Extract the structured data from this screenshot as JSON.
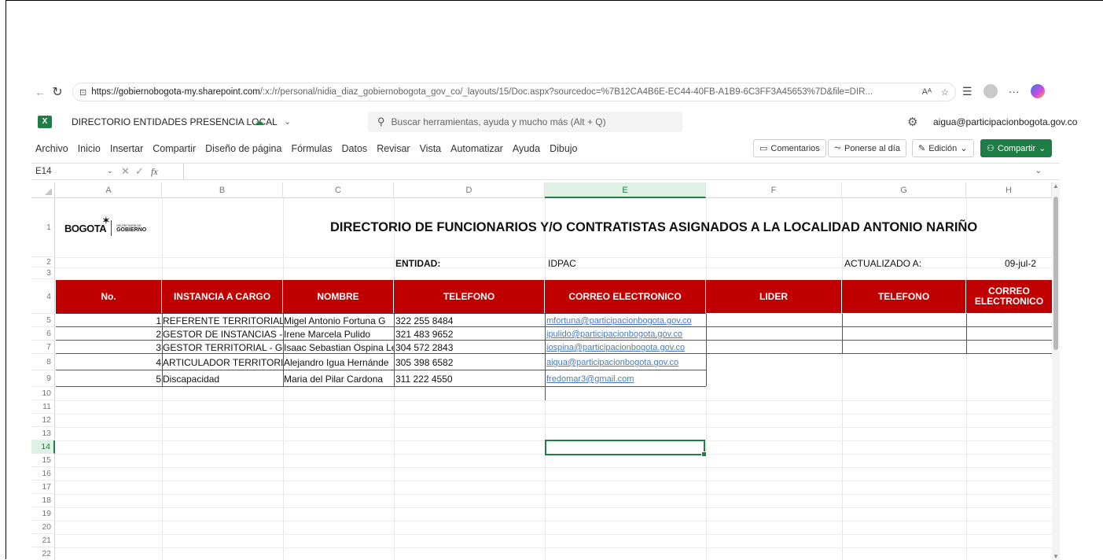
{
  "browser": {
    "url_host": "https://gobiernobogota-my.sharepoint.com",
    "url_rest": "/:x:/r/personal/nidia_diaz_gobiernobogota_gov_co/_layouts/15/Doc.aspx?sourcedoc=%7B12CA4B6E-EC44-40FB-A1B9-6C3FF3A45653%7D&file=DIR...",
    "read_aloud": "Aᴬ"
  },
  "excel": {
    "doc_name": "DIRECTORIO ENTIDADES PRESENCIA LOCAL",
    "search_placeholder": "Buscar herramientas, ayuda y mucho más (Alt + Q)",
    "account": "aigua@participacionbogota.gov.co",
    "tabs": [
      "Archivo",
      "Inicio",
      "Insertar",
      "Compartir",
      "Diseño de página",
      "Fórmulas",
      "Datos",
      "Revisar",
      "Vista",
      "Automatizar",
      "Ayuda",
      "Dibujo"
    ],
    "comments_label": "Comentarios",
    "catchup_label": "Ponerse al día",
    "edit_label": "Edición",
    "share_label": "Compartir",
    "name_box": "E14",
    "fx_label": "fx",
    "accent": "#1e7e45"
  },
  "sheet": {
    "columns": [
      "A",
      "B",
      "C",
      "D",
      "E",
      "F",
      "G",
      "H"
    ],
    "rows": [
      "1",
      "2",
      "3",
      "4",
      "5",
      "6",
      "7",
      "8",
      "9",
      "10",
      "11",
      "12",
      "13",
      "14",
      "15",
      "16",
      "17",
      "18",
      "19",
      "20",
      "21",
      "22"
    ],
    "selected_cell": "E14",
    "logo": {
      "city": "BOGOTA",
      "sec": "SECRETARÍA DE",
      "gob": "GOBIERNO"
    },
    "title": "DIRECTORIO DE FUNCIONARIOS Y/O CONTRATISTAS ASIGNADOS A LA LOCALIDAD ANTONIO NARIÑO",
    "entidad_label": "ENTIDAD:",
    "entidad_value": "IDPAC",
    "actualizado_label": "ACTUALIZADO A:",
    "actualizado_value": "09-jul-2",
    "header_color": "#c00000",
    "headers": [
      "No.",
      "INSTANCIA A CARGO",
      "NOMBRE",
      "TELEFONO",
      "CORREO ELECTRONICO",
      "LIDER",
      "TELEFONO",
      "CORREO ELECTRONICO"
    ],
    "data": [
      {
        "no": "1",
        "instancia": "REFERENTE TERRITORIAL - ",
        "nombre": "Migel Antonio Fortuna G",
        "telefono": "322 255 8484",
        "correo": "mfortuna@participacionbogota.gov.co"
      },
      {
        "no": "2",
        "instancia": "GESTOR DE INSTANCIAS - G",
        "nombre": "Irene Marcela Pulido",
        "telefono": "321 483 9652",
        "correo": "ipulido@participacionbogota.gov.co"
      },
      {
        "no": "3",
        "instancia": "GESTOR TERRITORIAL - Ger",
        "nombre": "Isaac Sebastian Ospina Le",
        "telefono": "304 572 2843",
        "correo": "iospina@participacionbogota.gov.co"
      },
      {
        "no": "4",
        "instancia": "ARTICULADOR TERRITORIA",
        "nombre": "Alejandro Igua Hernánde",
        "telefono": "305 398 6582",
        "correo": "aigua@participacionbogota.gov.co"
      },
      {
        "no": "5",
        "instancia": "Discapacidad",
        "nombre": "Maria del Pilar Cardona",
        "telefono": "311 222 4550",
        "correo": "fredomar3@gmail.com"
      }
    ]
  }
}
